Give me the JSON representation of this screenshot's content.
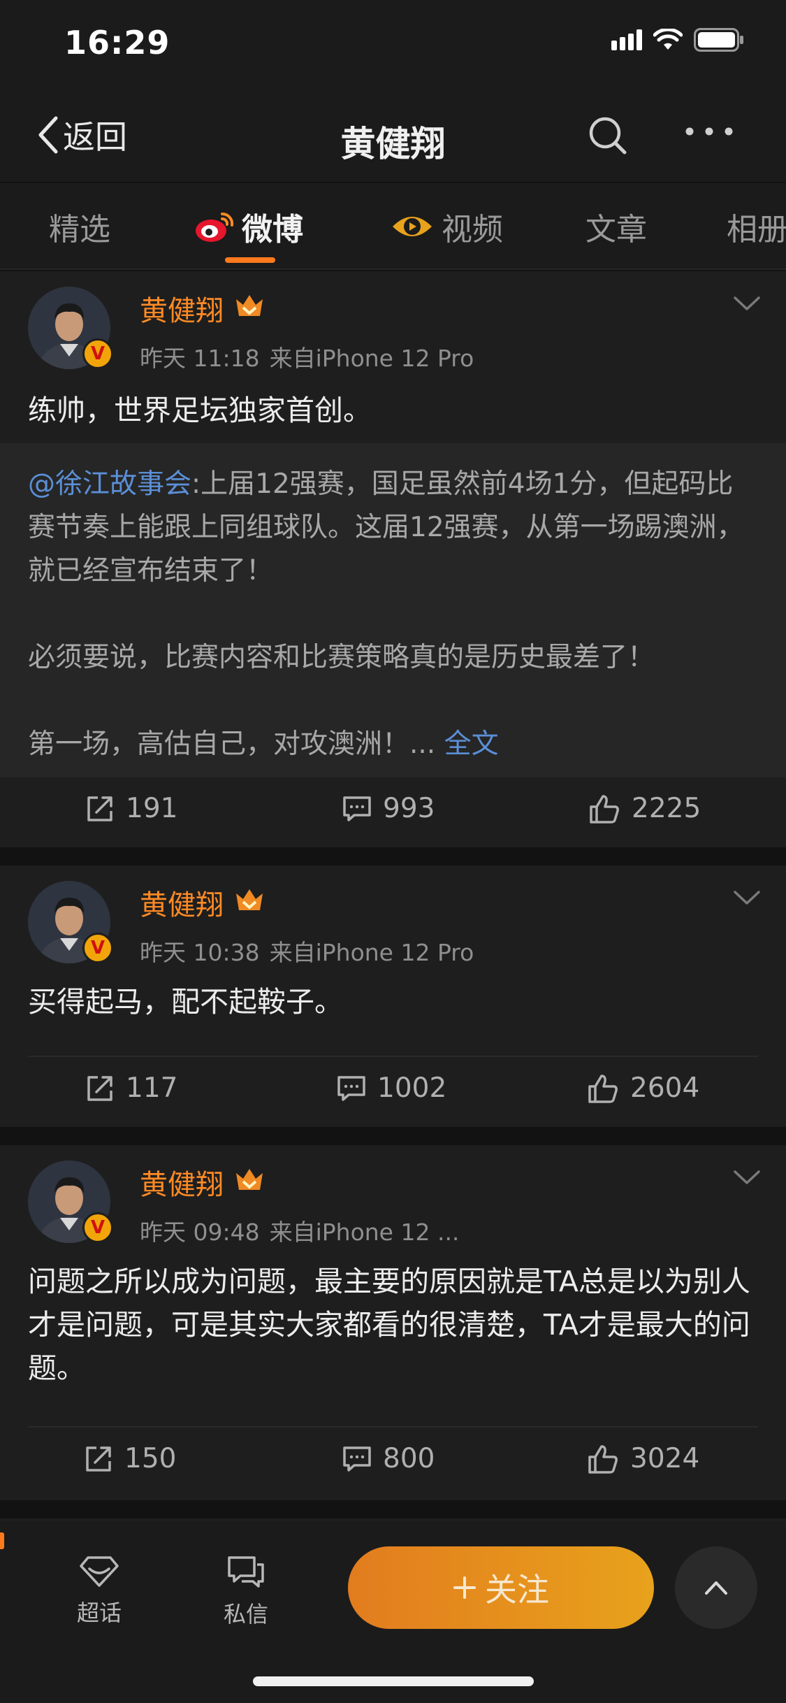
{
  "status_bar": {
    "time": "16:29"
  },
  "nav": {
    "back_label": "返回",
    "title": "黄健翔"
  },
  "tabs": [
    {
      "label": "精选"
    },
    {
      "label": "微博"
    },
    {
      "label": "视频"
    },
    {
      "label": "文章"
    },
    {
      "label": "相册"
    }
  ],
  "posts": [
    {
      "author": "黄健翔",
      "time": "昨天 11:18",
      "source": "来自iPhone 12 Pro",
      "text": "练帅，世界足坛独家首创。",
      "repost": {
        "mention": "@徐江故事会",
        "line1": ":上届12强赛，国足虽然前4场1分，但起码比赛节奏上能跟上同组球队。这届12强赛，从第一场踢澳洲，就已经宣布结束了！",
        "line2": "必须要说，比赛内容和比赛策略真的是历史最差了！",
        "line3": "第一场，高估自己，对攻澳洲！...",
        "fulltext": "全文"
      },
      "reposts": "191",
      "comments": "993",
      "likes": "2225"
    },
    {
      "author": "黄健翔",
      "time": "昨天 10:38",
      "source": "来自iPhone 12 Pro",
      "text": "买得起马，配不起鞍子。",
      "reposts": "117",
      "comments": "1002",
      "likes": "2604"
    },
    {
      "author": "黄健翔",
      "time": "昨天 09:48",
      "source": "来自iPhone 12 ...",
      "text": "问题之所以成为问题，最主要的原因就是TA总是以为别人才是问题，可是其实大家都看的很清楚，TA才是最大的问题。",
      "reposts": "150",
      "comments": "800",
      "likes": "3024"
    }
  ],
  "bottom_bar": {
    "supertopic_label": "超话",
    "message_label": "私信",
    "follow_label": "关注"
  },
  "colors": {
    "accent": "#ff7a1c",
    "author": "#ff8a24",
    "link": "#5b8fd6",
    "follow_start": "#e27c1e",
    "follow_end": "#e8a21c"
  },
  "icons": [
    "signal-icon",
    "wifi-icon",
    "battery-icon",
    "back-chevron-icon",
    "search-icon",
    "more-icon",
    "weibo-logo-icon",
    "video-icon",
    "repost-icon",
    "comment-icon",
    "like-icon",
    "diamond-icon",
    "message-icon",
    "plus-icon",
    "chevron-up-icon"
  ]
}
